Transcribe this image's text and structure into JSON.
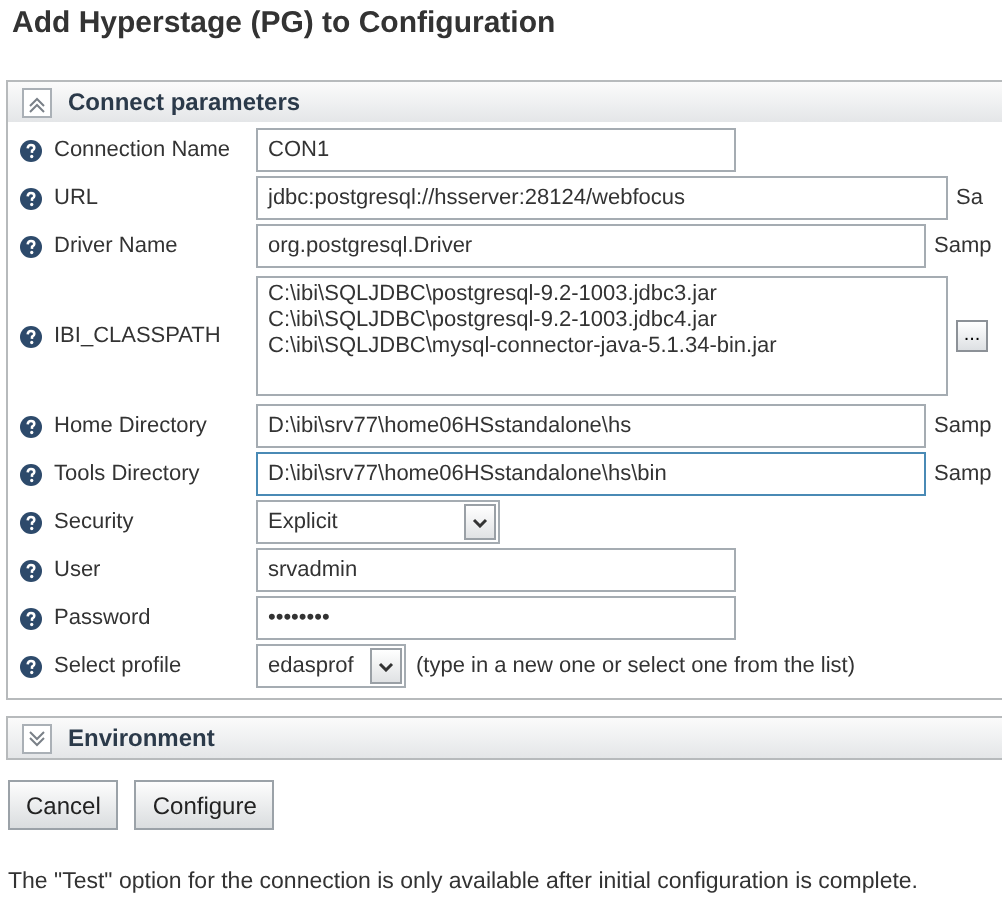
{
  "title": "Add Hyperstage (PG) to Configuration",
  "sections": [
    {
      "title": "Connect parameters",
      "expanded": true,
      "fields": [
        {
          "kind": "text",
          "label": "Connection Name",
          "value": "CON1",
          "focused": false
        },
        {
          "kind": "text",
          "label": "URL",
          "value": "jdbc:postgresql://hsserver:28124/webfocus",
          "hint": "Sa",
          "focused": false
        },
        {
          "kind": "text",
          "label": "Driver Name",
          "value": "org.postgresql.Driver",
          "hint": "Samp",
          "focused": false
        },
        {
          "kind": "textarea",
          "label": "IBI_CLASSPATH",
          "lines": [
            "C:\\ibi\\SQLJDBC\\postgresql-9.2-1003.jdbc3.jar",
            "C:\\ibi\\SQLJDBC\\postgresql-9.2-1003.jdbc4.jar",
            "C:\\ibi\\SQLJDBC\\mysql-connector-java-5.1.34-bin.jar"
          ],
          "button": "..."
        },
        {
          "kind": "text",
          "label": "Home Directory",
          "value": "D:\\ibi\\srv77\\home06HSstandalone\\hs",
          "hint": "Samp",
          "focused": false
        },
        {
          "kind": "text",
          "label": "Tools Directory",
          "value": "D:\\ibi\\srv77\\home06HSstandalone\\hs\\bin",
          "hint": "Samp",
          "focused": true
        },
        {
          "kind": "select",
          "label": "Security",
          "value": "Explicit"
        },
        {
          "kind": "text",
          "label": "User",
          "value": "srvadmin",
          "focused": false
        },
        {
          "kind": "text",
          "label": "Password",
          "value": "••••••••",
          "focused": false
        },
        {
          "kind": "combo",
          "label": "Select profile",
          "value": "edasprof",
          "note": "(type in a new one or select one from the list)"
        }
      ]
    },
    {
      "title": "Environment",
      "expanded": false
    }
  ],
  "buttons": [
    "Cancel",
    "Configure"
  ],
  "footer": "The \"Test\" option for the connection is only available after initial configuration is complete."
}
